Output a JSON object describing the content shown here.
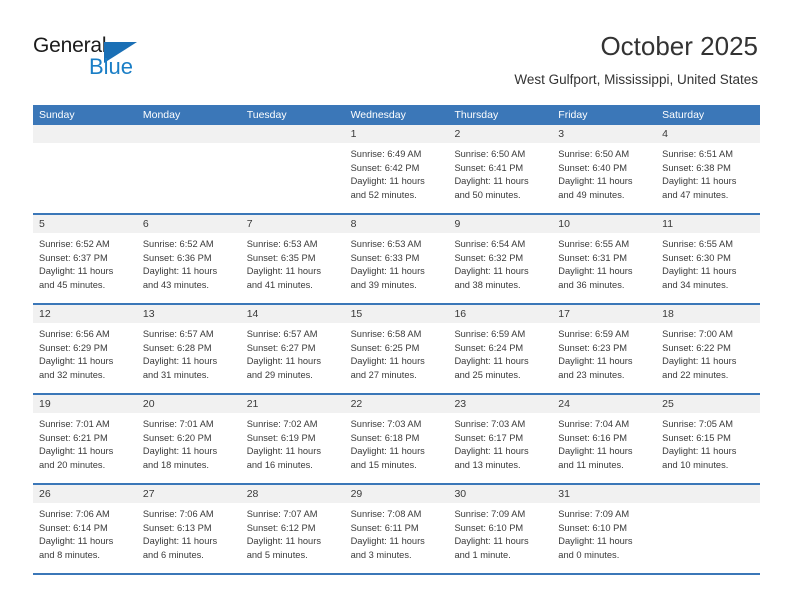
{
  "brand": {
    "name_top": "General",
    "name_bottom": "Blue",
    "accent_color": "#1a7ec6"
  },
  "header": {
    "month_title": "October 2025",
    "location": "West Gulfport, Mississippi, United States"
  },
  "calendar": {
    "header_color": "#3b77b8",
    "band_color": "#f1f1f1",
    "weekdays": [
      "Sunday",
      "Monday",
      "Tuesday",
      "Wednesday",
      "Thursday",
      "Friday",
      "Saturday"
    ],
    "weeks": [
      [
        {
          "empty": true
        },
        {
          "empty": true
        },
        {
          "empty": true
        },
        {
          "day": "1",
          "sunrise": "Sunrise: 6:49 AM",
          "sunset": "Sunset: 6:42 PM",
          "daylight_line1": "Daylight: 11 hours",
          "daylight_line2": "and 52 minutes."
        },
        {
          "day": "2",
          "sunrise": "Sunrise: 6:50 AM",
          "sunset": "Sunset: 6:41 PM",
          "daylight_line1": "Daylight: 11 hours",
          "daylight_line2": "and 50 minutes."
        },
        {
          "day": "3",
          "sunrise": "Sunrise: 6:50 AM",
          "sunset": "Sunset: 6:40 PM",
          "daylight_line1": "Daylight: 11 hours",
          "daylight_line2": "and 49 minutes."
        },
        {
          "day": "4",
          "sunrise": "Sunrise: 6:51 AM",
          "sunset": "Sunset: 6:38 PM",
          "daylight_line1": "Daylight: 11 hours",
          "daylight_line2": "and 47 minutes."
        }
      ],
      [
        {
          "day": "5",
          "sunrise": "Sunrise: 6:52 AM",
          "sunset": "Sunset: 6:37 PM",
          "daylight_line1": "Daylight: 11 hours",
          "daylight_line2": "and 45 minutes."
        },
        {
          "day": "6",
          "sunrise": "Sunrise: 6:52 AM",
          "sunset": "Sunset: 6:36 PM",
          "daylight_line1": "Daylight: 11 hours",
          "daylight_line2": "and 43 minutes."
        },
        {
          "day": "7",
          "sunrise": "Sunrise: 6:53 AM",
          "sunset": "Sunset: 6:35 PM",
          "daylight_line1": "Daylight: 11 hours",
          "daylight_line2": "and 41 minutes."
        },
        {
          "day": "8",
          "sunrise": "Sunrise: 6:53 AM",
          "sunset": "Sunset: 6:33 PM",
          "daylight_line1": "Daylight: 11 hours",
          "daylight_line2": "and 39 minutes."
        },
        {
          "day": "9",
          "sunrise": "Sunrise: 6:54 AM",
          "sunset": "Sunset: 6:32 PM",
          "daylight_line1": "Daylight: 11 hours",
          "daylight_line2": "and 38 minutes."
        },
        {
          "day": "10",
          "sunrise": "Sunrise: 6:55 AM",
          "sunset": "Sunset: 6:31 PM",
          "daylight_line1": "Daylight: 11 hours",
          "daylight_line2": "and 36 minutes."
        },
        {
          "day": "11",
          "sunrise": "Sunrise: 6:55 AM",
          "sunset": "Sunset: 6:30 PM",
          "daylight_line1": "Daylight: 11 hours",
          "daylight_line2": "and 34 minutes."
        }
      ],
      [
        {
          "day": "12",
          "sunrise": "Sunrise: 6:56 AM",
          "sunset": "Sunset: 6:29 PM",
          "daylight_line1": "Daylight: 11 hours",
          "daylight_line2": "and 32 minutes."
        },
        {
          "day": "13",
          "sunrise": "Sunrise: 6:57 AM",
          "sunset": "Sunset: 6:28 PM",
          "daylight_line1": "Daylight: 11 hours",
          "daylight_line2": "and 31 minutes."
        },
        {
          "day": "14",
          "sunrise": "Sunrise: 6:57 AM",
          "sunset": "Sunset: 6:27 PM",
          "daylight_line1": "Daylight: 11 hours",
          "daylight_line2": "and 29 minutes."
        },
        {
          "day": "15",
          "sunrise": "Sunrise: 6:58 AM",
          "sunset": "Sunset: 6:25 PM",
          "daylight_line1": "Daylight: 11 hours",
          "daylight_line2": "and 27 minutes."
        },
        {
          "day": "16",
          "sunrise": "Sunrise: 6:59 AM",
          "sunset": "Sunset: 6:24 PM",
          "daylight_line1": "Daylight: 11 hours",
          "daylight_line2": "and 25 minutes."
        },
        {
          "day": "17",
          "sunrise": "Sunrise: 6:59 AM",
          "sunset": "Sunset: 6:23 PM",
          "daylight_line1": "Daylight: 11 hours",
          "daylight_line2": "and 23 minutes."
        },
        {
          "day": "18",
          "sunrise": "Sunrise: 7:00 AM",
          "sunset": "Sunset: 6:22 PM",
          "daylight_line1": "Daylight: 11 hours",
          "daylight_line2": "and 22 minutes."
        }
      ],
      [
        {
          "day": "19",
          "sunrise": "Sunrise: 7:01 AM",
          "sunset": "Sunset: 6:21 PM",
          "daylight_line1": "Daylight: 11 hours",
          "daylight_line2": "and 20 minutes."
        },
        {
          "day": "20",
          "sunrise": "Sunrise: 7:01 AM",
          "sunset": "Sunset: 6:20 PM",
          "daylight_line1": "Daylight: 11 hours",
          "daylight_line2": "and 18 minutes."
        },
        {
          "day": "21",
          "sunrise": "Sunrise: 7:02 AM",
          "sunset": "Sunset: 6:19 PM",
          "daylight_line1": "Daylight: 11 hours",
          "daylight_line2": "and 16 minutes."
        },
        {
          "day": "22",
          "sunrise": "Sunrise: 7:03 AM",
          "sunset": "Sunset: 6:18 PM",
          "daylight_line1": "Daylight: 11 hours",
          "daylight_line2": "and 15 minutes."
        },
        {
          "day": "23",
          "sunrise": "Sunrise: 7:03 AM",
          "sunset": "Sunset: 6:17 PM",
          "daylight_line1": "Daylight: 11 hours",
          "daylight_line2": "and 13 minutes."
        },
        {
          "day": "24",
          "sunrise": "Sunrise: 7:04 AM",
          "sunset": "Sunset: 6:16 PM",
          "daylight_line1": "Daylight: 11 hours",
          "daylight_line2": "and 11 minutes."
        },
        {
          "day": "25",
          "sunrise": "Sunrise: 7:05 AM",
          "sunset": "Sunset: 6:15 PM",
          "daylight_line1": "Daylight: 11 hours",
          "daylight_line2": "and 10 minutes."
        }
      ],
      [
        {
          "day": "26",
          "sunrise": "Sunrise: 7:06 AM",
          "sunset": "Sunset: 6:14 PM",
          "daylight_line1": "Daylight: 11 hours",
          "daylight_line2": "and 8 minutes."
        },
        {
          "day": "27",
          "sunrise": "Sunrise: 7:06 AM",
          "sunset": "Sunset: 6:13 PM",
          "daylight_line1": "Daylight: 11 hours",
          "daylight_line2": "and 6 minutes."
        },
        {
          "day": "28",
          "sunrise": "Sunrise: 7:07 AM",
          "sunset": "Sunset: 6:12 PM",
          "daylight_line1": "Daylight: 11 hours",
          "daylight_line2": "and 5 minutes."
        },
        {
          "day": "29",
          "sunrise": "Sunrise: 7:08 AM",
          "sunset": "Sunset: 6:11 PM",
          "daylight_line1": "Daylight: 11 hours",
          "daylight_line2": "and 3 minutes."
        },
        {
          "day": "30",
          "sunrise": "Sunrise: 7:09 AM",
          "sunset": "Sunset: 6:10 PM",
          "daylight_line1": "Daylight: 11 hours",
          "daylight_line2": "and 1 minute."
        },
        {
          "day": "31",
          "sunrise": "Sunrise: 7:09 AM",
          "sunset": "Sunset: 6:10 PM",
          "daylight_line1": "Daylight: 11 hours",
          "daylight_line2": "and 0 minutes."
        },
        {
          "empty": true
        }
      ]
    ]
  }
}
